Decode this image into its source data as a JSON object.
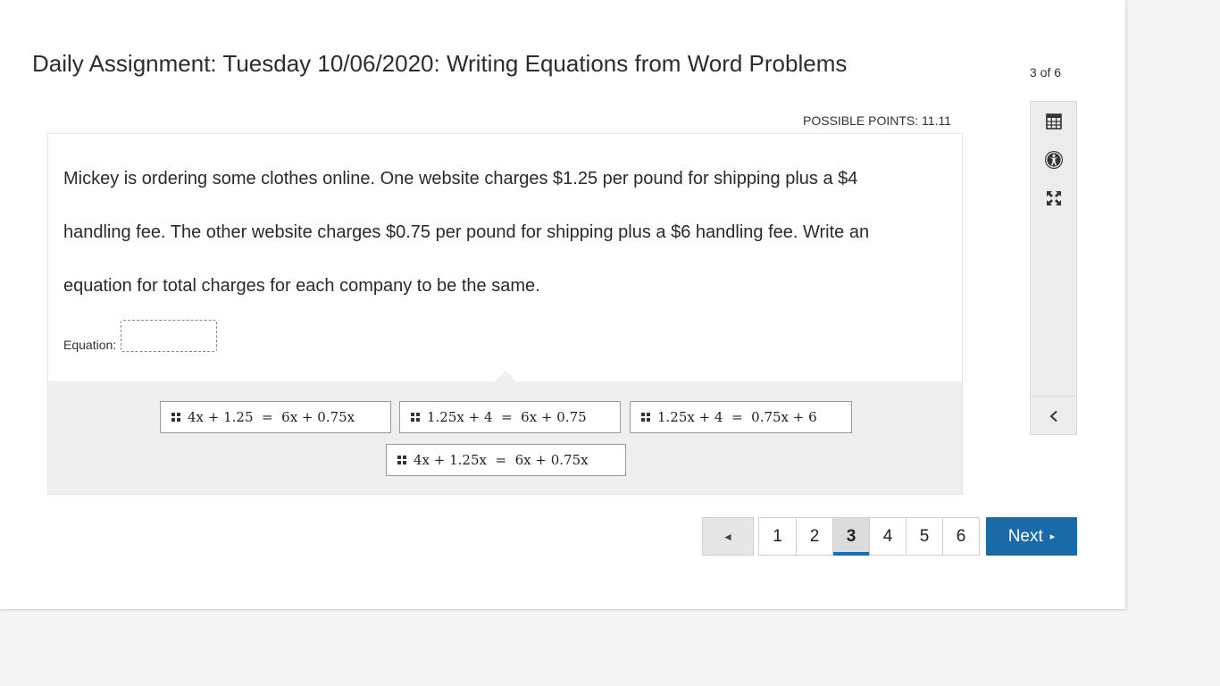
{
  "header": {
    "title": "Daily Assignment: Tuesday 10/06/2020: Writing Equations from Word Problems",
    "progress": "3 of 6"
  },
  "question": {
    "points_label": "POSSIBLE POINTS: 11.11",
    "text": "Mickey is ordering some clothes online.  One website charges $1.25 per pound for shipping plus a $4\nhandling fee.  The other website charges $0.75 per pound for shipping plus a $6 handling fee.  Write an\nequation for total charges for each company to be the same.",
    "equation_label": "Equation:"
  },
  "choices": [
    "4x + 1.25  =  6x + 0.75x",
    "1.25x + 4  =  6x + 0.75",
    "1.25x + 4  =  0.75x + 6",
    "4x + 1.25x  =  6x + 0.75x"
  ],
  "sidebar": {
    "icons": [
      "calculator-icon",
      "accessibility-icon",
      "fullscreen-icon"
    ],
    "collapse_icon": "chevron-left-icon"
  },
  "pagination": {
    "prev_glyph": "◄",
    "pages": [
      "1",
      "2",
      "3",
      "4",
      "5",
      "6"
    ],
    "active_page": "3",
    "next_label": "Next",
    "next_glyph": "▸",
    "accent_color": "#1b6aa8"
  }
}
